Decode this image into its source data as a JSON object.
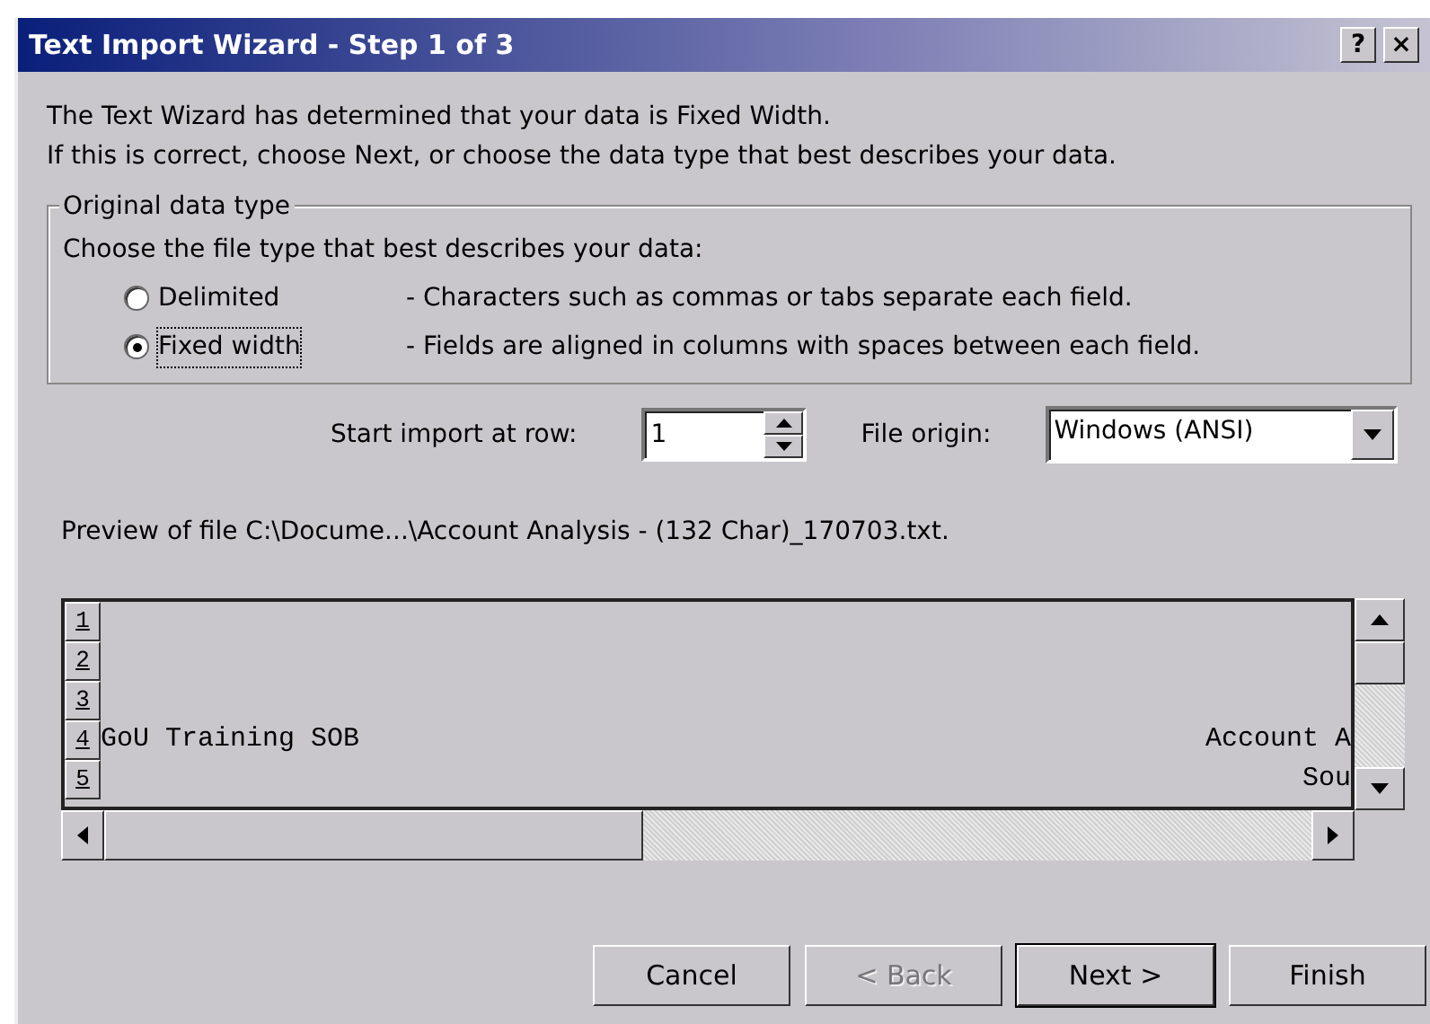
{
  "window": {
    "title": "Text Import Wizard - Step 1 of 3",
    "title_buttons": [
      "?",
      "×"
    ]
  },
  "intro": [
    "The Text Wizard has determined that your data is Fixed Width.",
    "If this is correct, choose Next, or choose the data type that best describes your data."
  ],
  "group": {
    "legend": "Original data type",
    "prompt": "Choose the file type that best describes your data:",
    "options": [
      {
        "label": "Delimited",
        "description": "- Characters such as commas or tabs separate each field.",
        "selected": false,
        "focused": false
      },
      {
        "label": "Fixed width",
        "description": "- Fields are aligned in columns with spaces between each field.",
        "selected": true,
        "focused": true
      }
    ]
  },
  "start_row": {
    "label": "Start import at row:",
    "value": "1"
  },
  "file_origin": {
    "label": "File origin:",
    "value": "Windows (ANSI)"
  },
  "preview": {
    "caption": "Preview of file C:\\Docume...\\Account Analysis - (132 Char)_170703.txt.",
    "rows": [
      {
        "number": "1"
      },
      {
        "number": "2"
      },
      {
        "number": "3"
      },
      {
        "number": "4",
        "left": "GoU Training SOB",
        "right": "Account A"
      },
      {
        "number": "5",
        "right": "Sou"
      }
    ]
  },
  "buttons": [
    {
      "label": "Cancel",
      "disabled": false,
      "default": false
    },
    {
      "label": "< Back",
      "disabled": true,
      "default": false
    },
    {
      "label": "Next >",
      "disabled": false,
      "default": true
    },
    {
      "label": "Finish",
      "disabled": false,
      "default": false
    }
  ]
}
